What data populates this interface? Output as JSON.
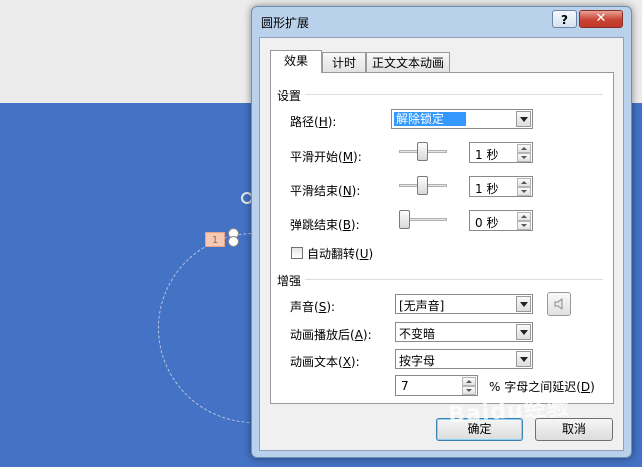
{
  "slide": {
    "animation_tag": "1"
  },
  "dialog": {
    "title": "圆形扩展",
    "help_label": "?",
    "close_label": "✕",
    "tabs": [
      {
        "label": "效果"
      },
      {
        "label": "计时"
      },
      {
        "label": "正文文本动画"
      }
    ],
    "settings": {
      "group_label": "设置",
      "path": {
        "label": "路径(",
        "mnemonic": "H",
        "suffix": "):",
        "value": "解除锁定"
      },
      "smooth_start": {
        "label": "平滑开始(",
        "mnemonic": "M",
        "suffix": "):",
        "value": "1 秒",
        "level": 0.5
      },
      "smooth_end": {
        "label": "平滑结束(",
        "mnemonic": "N",
        "suffix": "):",
        "value": "1 秒",
        "level": 0.5
      },
      "bounce_end": {
        "label": "弹跳结束(",
        "mnemonic": "B",
        "suffix": "):",
        "value": "0 秒",
        "level": 0.0
      },
      "auto_reverse": {
        "label": "自动翻转(",
        "mnemonic": "U",
        "suffix": ")",
        "checked": false
      }
    },
    "enhance": {
      "group_label": "增强",
      "sound": {
        "label": "声音(",
        "mnemonic": "S",
        "suffix": "):",
        "value": "[无声音]"
      },
      "after_animation": {
        "label": "动画播放后(",
        "mnemonic": "A",
        "suffix": "):",
        "value": "不变暗"
      },
      "animate_text": {
        "label": "动画文本(",
        "mnemonic": "X",
        "suffix": "):",
        "value": "按字母"
      },
      "delay": {
        "value": "7",
        "label": "% 字母之间延迟(",
        "mnemonic": "D",
        "suffix": ")"
      }
    },
    "buttons": {
      "ok": "确定",
      "cancel": "取消"
    }
  },
  "watermark": "Baidu经验",
  "colors": {
    "slide_bg": "#4472c4",
    "dialog_frame": "#b9d1ea",
    "close_button": "#c84334",
    "selection": "#3399ff"
  }
}
